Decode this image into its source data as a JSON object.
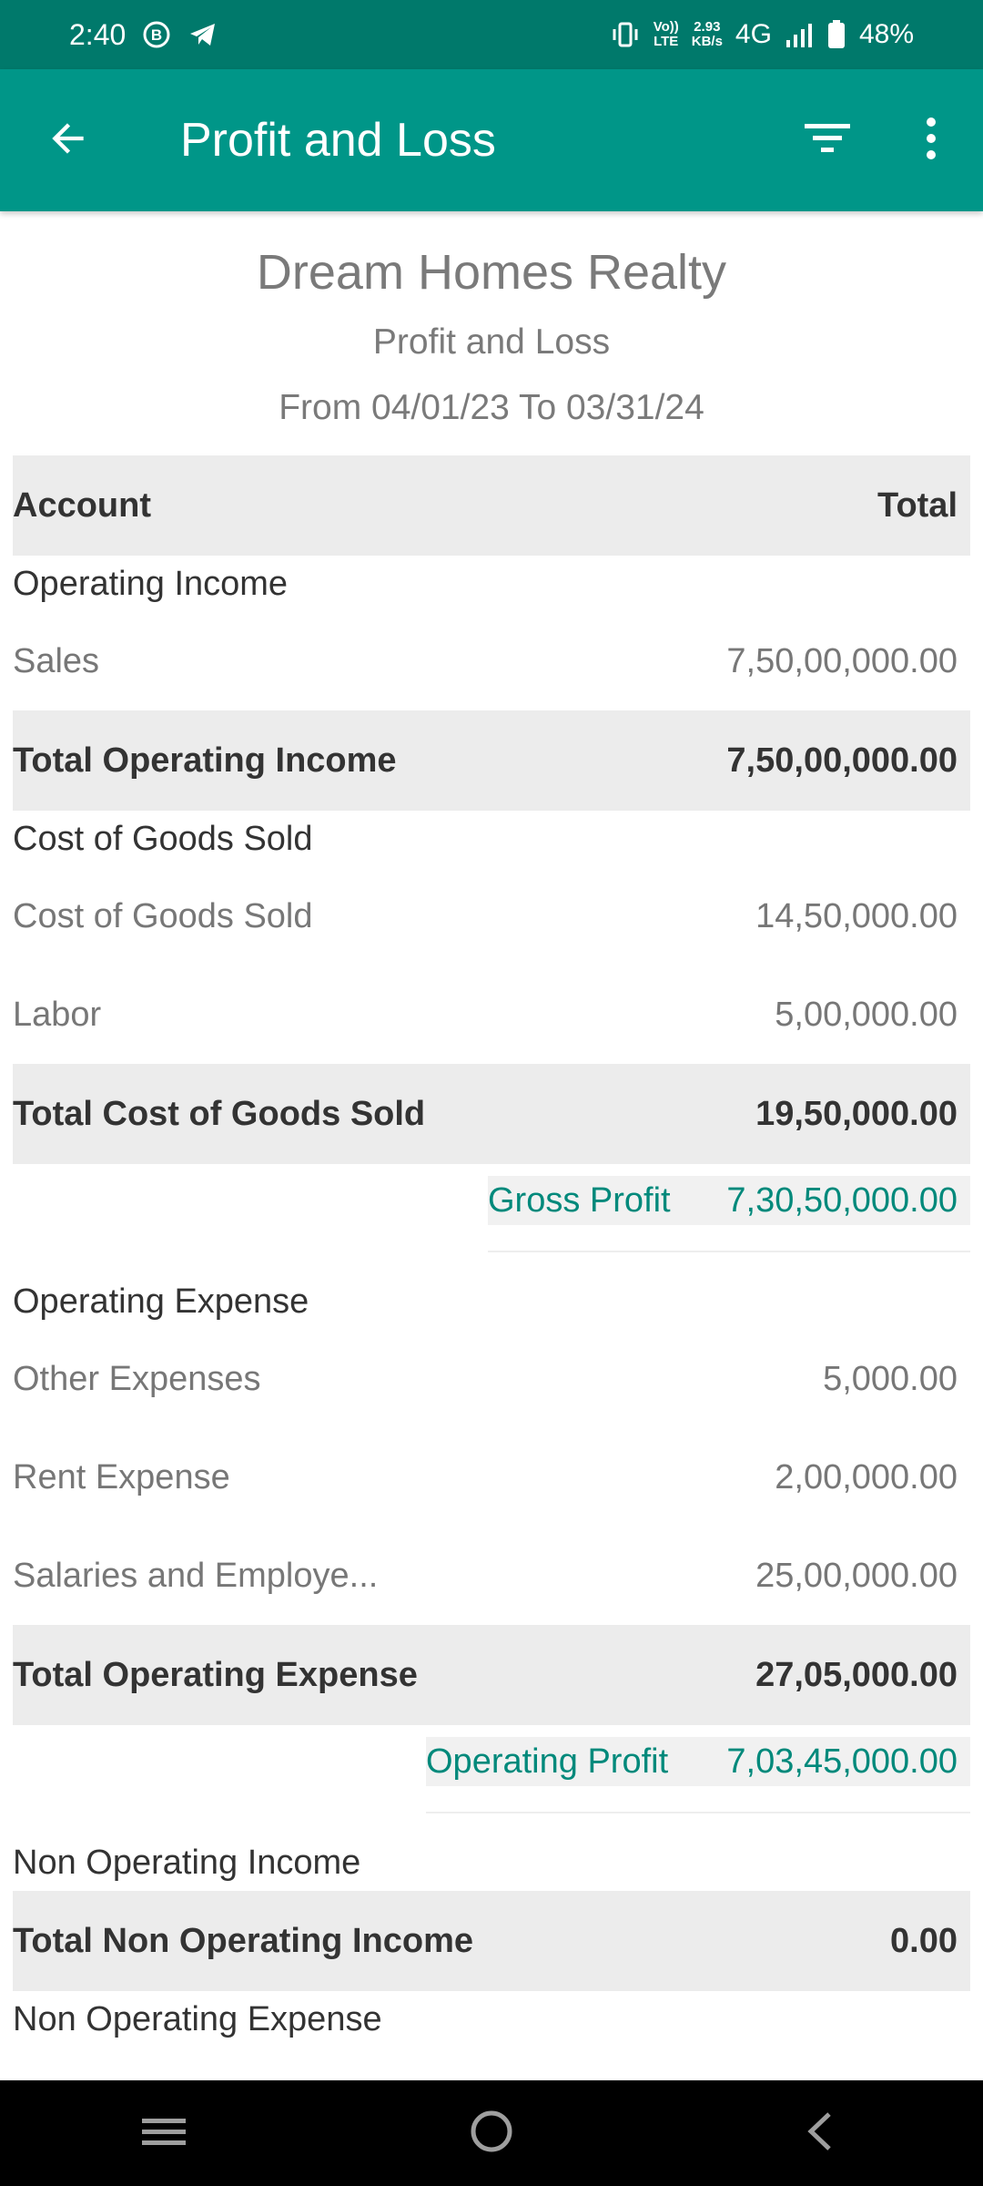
{
  "status_bar": {
    "time": "2:40",
    "net_speed_value": "2.93",
    "net_speed_unit": "KB/s",
    "volte_top": "Vo))",
    "volte_bottom": "LTE",
    "network": "4G",
    "battery": "48%",
    "icons": [
      "b-badge-icon",
      "telegram-icon",
      "vibrate-icon",
      "signal-icon",
      "battery-icon"
    ]
  },
  "app_bar": {
    "title": "Profit and Loss",
    "icons": [
      "back-arrow-icon",
      "filter-icon",
      "more-vert-icon"
    ]
  },
  "report": {
    "company": "Dream Homes Realty",
    "title": "Profit and Loss",
    "period": "From 04/01/23 To 03/31/24"
  },
  "table": {
    "header": {
      "account": "Account",
      "total": "Total"
    },
    "operating_income": {
      "title": "Operating Income",
      "items": [
        {
          "label": "Sales",
          "value": "7,50,00,000.00"
        }
      ],
      "total_label": "Total Operating Income",
      "total_value": "7,50,00,000.00"
    },
    "cogs": {
      "title": "Cost of Goods Sold",
      "items": [
        {
          "label": "Cost of Goods Sold",
          "value": "14,50,000.00"
        },
        {
          "label": "Labor",
          "value": "5,00,000.00"
        }
      ],
      "total_label": "Total Cost of Goods Sold",
      "total_value": "19,50,000.00"
    },
    "gross_profit": {
      "label": "Gross Profit",
      "value": "7,30,50,000.00"
    },
    "operating_expense": {
      "title": "Operating Expense",
      "items": [
        {
          "label": "Other Expenses",
          "value": "5,000.00"
        },
        {
          "label": "Rent Expense",
          "value": "2,00,000.00"
        },
        {
          "label": "Salaries and Employe...",
          "value": "25,00,000.00"
        }
      ],
      "total_label": "Total Operating Expense",
      "total_value": "27,05,000.00"
    },
    "operating_profit": {
      "label": "Operating Profit",
      "value": "7,03,45,000.00"
    },
    "non_operating_income": {
      "title": "Non Operating Income",
      "total_label": "Total Non Operating Income",
      "total_value": "0.00"
    },
    "non_operating_expense": {
      "title": "Non Operating Expense"
    }
  },
  "nav_bar": {
    "icons": [
      "recent-apps-icon",
      "home-icon",
      "back-icon"
    ]
  },
  "colors": {
    "status_bar": "#00796b",
    "app_bar": "#009688",
    "accent_text": "#00897b",
    "row_shade": "#ececec"
  }
}
